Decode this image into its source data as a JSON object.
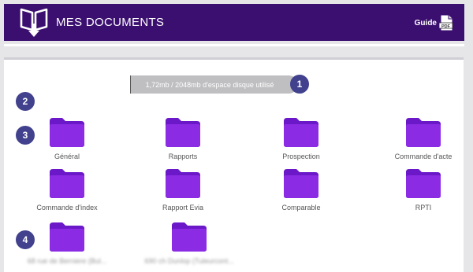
{
  "header": {
    "title": "MES DOCUMENTS",
    "guide_label": "Guide",
    "pdf_badge": "PDF",
    "background": "#3b0f6f"
  },
  "storage": {
    "text": "1,72mb / 2048mb d'espace disque utilisé"
  },
  "badges": [
    "1",
    "2",
    "3",
    "4"
  ],
  "folders": {
    "row1": [
      "Général",
      "Rapports",
      "Prospection",
      "Commande d'acte"
    ],
    "row2": [
      "Commande d'index",
      "Rapport Evia",
      "Comparable",
      "RPTI"
    ],
    "row3": [
      "68 rue de Berniere (Bul...",
      "690 ch Dunlop (Tuleurcont..."
    ]
  },
  "colors": {
    "folder": "#8b2be3",
    "badge": "#41418e",
    "storage_bar": "#bfbfc2"
  },
  "icons": {
    "app": "book-download-icon",
    "guide": "pdf-file-icon",
    "folder": "folder-icon"
  }
}
